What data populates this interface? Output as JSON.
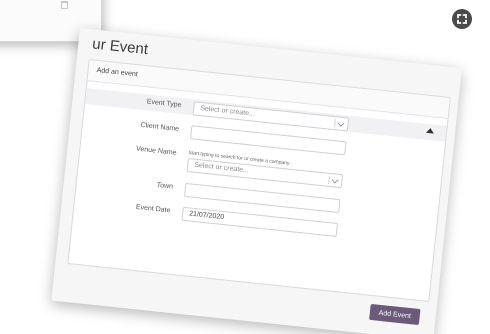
{
  "page": {
    "title": "ur Event"
  },
  "form": {
    "header": "Add an event",
    "fields": {
      "event_type": {
        "label": "Event Type",
        "placeholder": "Select or create..."
      },
      "client_name": {
        "label": "Client Name",
        "value": ""
      },
      "venue_name": {
        "label": "Venue Name",
        "hint": "Start typing to search for or create a company",
        "placeholder": "Select or create..."
      },
      "town": {
        "label": "Town",
        "value": ""
      },
      "event_date": {
        "label": "Event Date",
        "value": "21/07/2020"
      }
    },
    "submit_label": "Add Event"
  },
  "icons": {
    "fullscreen": "fullscreen-icon",
    "collapse": "caret-up-icon",
    "trash": "trash-icon"
  },
  "colors": {
    "button_bg": "#6b5a7a",
    "fullscreen_icon": "#4a4a4a"
  }
}
